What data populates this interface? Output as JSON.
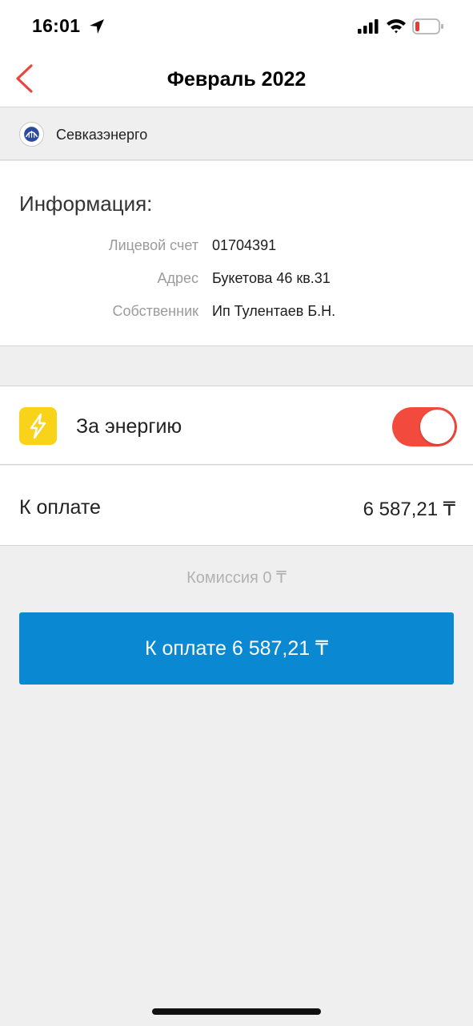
{
  "status_bar": {
    "time": "16:01",
    "icons": [
      "location-arrow-icon",
      "cell-signal-icon",
      "wifi-icon",
      "battery-icon"
    ]
  },
  "nav": {
    "title": "Февраль 2022",
    "back_icon": "chevron-left-icon"
  },
  "provider": {
    "name": "Севказэнерго",
    "logo_icon": "provider-logo-icon"
  },
  "info": {
    "heading": "Информация:",
    "rows": [
      {
        "label": "Лицевой счет",
        "value": "01704391"
      },
      {
        "label": "Адрес",
        "value": "Букетова 46 кв.31"
      },
      {
        "label": "Собственник",
        "value": "Ип Тулентаев Б.Н."
      }
    ]
  },
  "service": {
    "label": "За энергию",
    "icon": "lightning-icon",
    "enabled": true
  },
  "payment": {
    "label": "К оплате",
    "amount": "6 587,21 ₸",
    "commission": "Комиссия 0 ₸",
    "button_label": "К оплате 6 587,21 ₸"
  },
  "colors": {
    "accent_blue": "#0a88d1",
    "toggle_red": "#f24b3e",
    "back_red": "#e8453c",
    "bolt_yellow": "#f9d21a",
    "background": "#efefef"
  }
}
